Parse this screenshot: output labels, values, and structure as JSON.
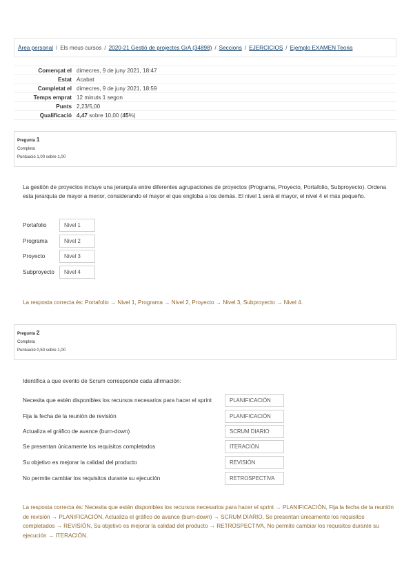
{
  "breadcrumb": {
    "home": "Àrea personal",
    "my_courses": "Els meus cursos",
    "course": "2020-21 Gestió de projectes GrA (34898)",
    "sections": "Seccions",
    "exercises": "EJERCICIOS",
    "quiz": "Ejemplo EXAMEN Teoria",
    "separator": "/"
  },
  "summary": [
    {
      "label": "Començat el",
      "value": "dimecres, 9 de juny 2021, 18:47"
    },
    {
      "label": "Estat",
      "value": "Acabat"
    },
    {
      "label": "Completat el",
      "value": "dimecres, 9 de juny 2021, 18:59"
    },
    {
      "label": "Temps emprat",
      "value": "12 minuts 1 segon"
    },
    {
      "label": "Punts",
      "value": "2,23/5,00"
    }
  ],
  "grade": {
    "label": "Qualificació",
    "score": "4,47",
    "middle": " sobre 10,00 (",
    "percent": "45",
    "suffix": "%)"
  },
  "q1": {
    "label": "Pregunta",
    "number": "1",
    "status": "Completa",
    "points": "Puntuació 1,00 sobre 1,00",
    "text": "La gestión de proyectos incluye una jerarquía entre diferentes agrupaciones de proyectos (Programa, Proyecto, Portafolio, Subproyecto). Ordena esta jerarquía de mayor a menor, considerando el mayor el que engloba a los demás. El nivel 1 será el mayor, el nivel 4 el más pequeño.",
    "rows": [
      {
        "label": "Portafolio",
        "answer": "Nivel 1"
      },
      {
        "label": "Programa",
        "answer": "Nivel 2"
      },
      {
        "label": "Proyecto",
        "answer": "Nivel 3"
      },
      {
        "label": "Subproyecto",
        "answer": "Nivel 4"
      }
    ],
    "correct": "La resposta correcta és: Portafolio → Nivel 1, Programa → Nivel 2, Proyecto → Nivel 3, Subproyecto → Nivel 4."
  },
  "q2": {
    "label": "Pregunta",
    "number": "2",
    "status": "Completa",
    "points": "Puntuació 0,50 sobre 1,00",
    "text": "Identifica a que evento de Scrum corresponde cada afirmación:",
    "rows": [
      {
        "label": "Necesita que estén disponibles los recursos necesarios para hacer el sprint",
        "answer": "PLANIFICACIÓN"
      },
      {
        "label": "Fija la fecha de la reunión de revisión",
        "answer": "PLANIFICACIÓN"
      },
      {
        "label": "Actualiza el gráfico de avance (burn-down)",
        "answer": "SCRUM DIARIO"
      },
      {
        "label": "Se presentan únicamente los requisitos completados",
        "answer": "ITERACIÓN"
      },
      {
        "label": "Su objetivo es mejorar la calidad del producto",
        "answer": "REVISIÓN"
      },
      {
        "label": "No permite cambiar los requisitos durante su ejecución",
        "answer": "RETROSPECTIVA"
      }
    ],
    "correct": "La resposta correcta és: Necesita que estén disponibles los recursos necesarios para hacer el sprint → PLANIFICACIÓN, Fija la fecha de la reunión de revisión → PLANIFICACIÓN, Actualiza el gráfico de avance (burn-down) → SCRUM DIARIO, Se presentan únicamente los requisitos completados → REVISIÓN, Su objetivo es mejorar la calidad del producto → RETROSPECTIVA, No permite cambiar los requisitos durante su ejecución → ITERACIÓN."
  }
}
